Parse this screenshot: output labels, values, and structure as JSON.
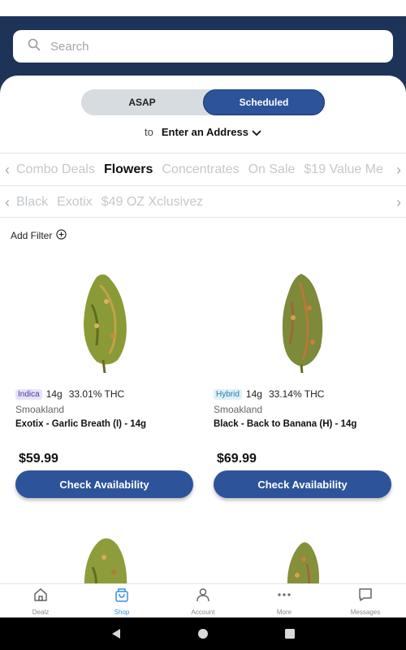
{
  "search": {
    "placeholder": "Search"
  },
  "delivery_toggle": {
    "options": [
      "ASAP",
      "Scheduled"
    ],
    "selected": "Scheduled"
  },
  "address": {
    "prefix": "to",
    "value": "Enter an Address"
  },
  "categories": [
    "Combo Deals",
    "Flowers",
    "Concentrates",
    "On Sale",
    "$19 Value Me"
  ],
  "active_category": "Flowers",
  "subcategories": [
    "Black",
    "Exotix",
    "$49 OZ Xclusivez"
  ],
  "filter": {
    "label": "Add Filter"
  },
  "products": [
    {
      "strain_type": "Indica",
      "weight": "14g",
      "thc": "33.01% THC",
      "brand": "Smoakland",
      "name": "Exotix - Garlic Breath (I) - 14g",
      "price": "$59.99",
      "cta": "Check Availability"
    },
    {
      "strain_type": "Hybrid",
      "weight": "14g",
      "thc": "33.14% THC",
      "brand": "Smoakland",
      "name": "Black - Back to Banana (H) - 14g",
      "price": "$69.99",
      "cta": "Check Availability"
    }
  ],
  "tabs": [
    {
      "label": "Dealz",
      "icon": "home-icon"
    },
    {
      "label": "Shop",
      "icon": "shopping-bag-icon",
      "active": true
    },
    {
      "label": "Account",
      "icon": "person-icon"
    },
    {
      "label": "More",
      "icon": "more-dots-icon"
    },
    {
      "label": "Messages",
      "icon": "chat-icon"
    }
  ],
  "colors": {
    "header": "#1e3358",
    "accent": "#2d549a",
    "active_tab": "#3a8fe0"
  }
}
